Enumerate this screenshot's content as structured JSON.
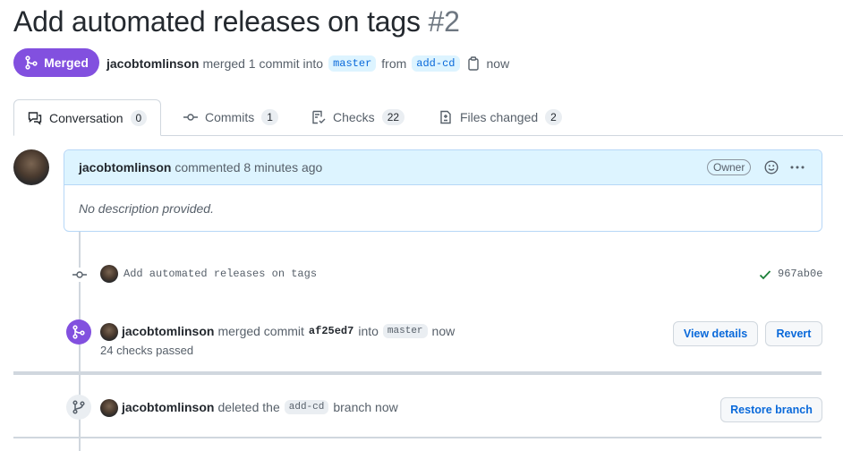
{
  "pr": {
    "title": "Add automated releases on tags",
    "number": "#2",
    "status": "Merged",
    "author": "jacobtomlinson",
    "merged_text": "merged 1 commit into",
    "base_branch": "master",
    "from_text": "from",
    "head_branch": "add-cd",
    "time": "now"
  },
  "tabs": [
    {
      "label": "Conversation",
      "count": "0",
      "icon": "comment-discussion-icon"
    },
    {
      "label": "Commits",
      "count": "1",
      "icon": "git-commit-icon"
    },
    {
      "label": "Checks",
      "count": "22",
      "icon": "checklist-icon"
    },
    {
      "label": "Files changed",
      "count": "2",
      "icon": "file-diff-icon"
    }
  ],
  "comment": {
    "author": "jacobtomlinson",
    "action": "commented 8 minutes ago",
    "role": "Owner",
    "body": "No description provided."
  },
  "commit": {
    "message": "Add automated releases on tags",
    "sha": "967ab0e",
    "status_icon": "check-icon",
    "status_color": "#1a7f37"
  },
  "merge_event": {
    "author": "jacobtomlinson",
    "text1": "merged commit",
    "commit": "af25ed7",
    "text2": "into",
    "branch": "master",
    "time": "now",
    "checks": "24 checks passed",
    "view_details": "View details",
    "revert": "Revert"
  },
  "delete_event": {
    "author": "jacobtomlinson",
    "text1": "deleted the",
    "branch": "add-cd",
    "text2": "branch now",
    "restore": "Restore branch"
  },
  "colors": {
    "merged": "#8250df",
    "link": "#0969da",
    "border": "#d0d7de"
  }
}
